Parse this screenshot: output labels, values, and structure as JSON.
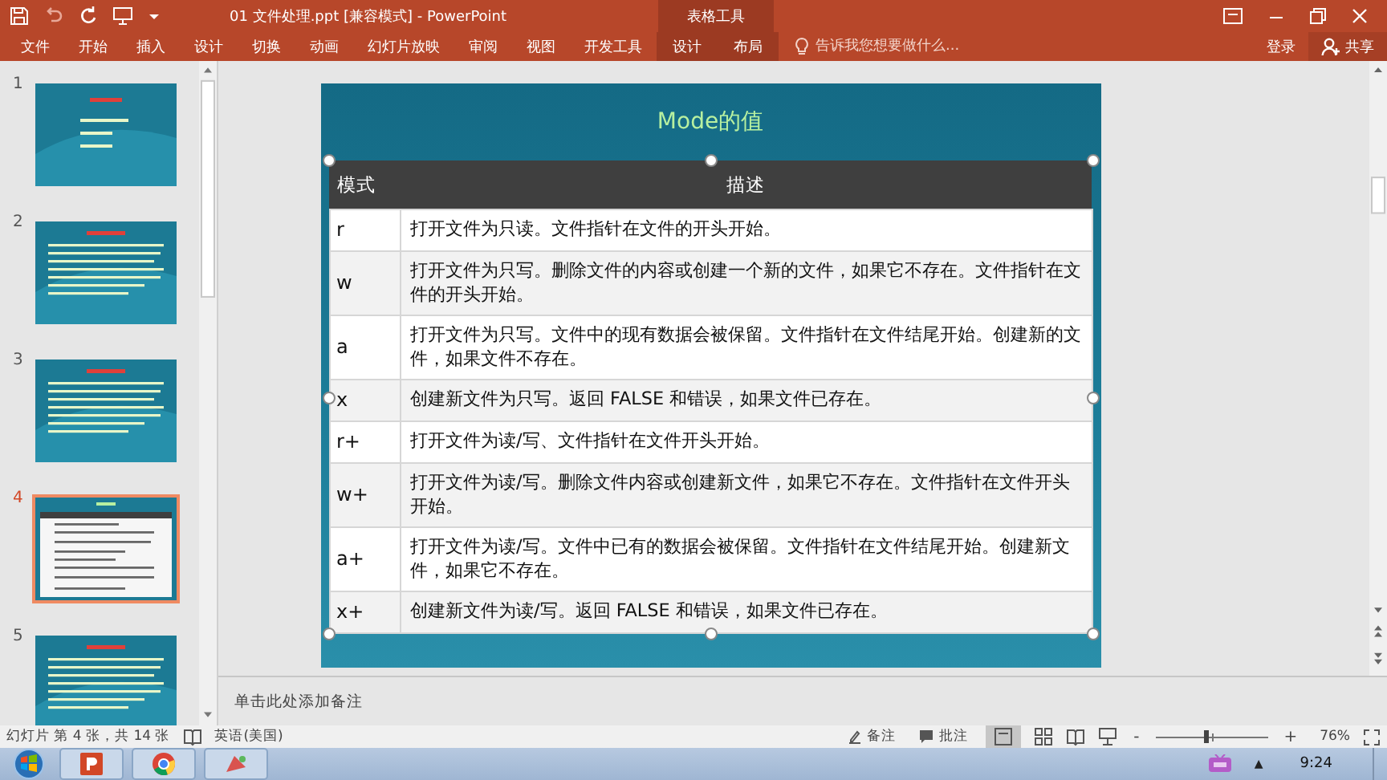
{
  "title_bar": {
    "title": "01  文件处理.ppt [兼容模式] - PowerPoint",
    "context_group": "表格工具"
  },
  "ribbon_tabs": [
    {
      "label": "文件",
      "contextual": false
    },
    {
      "label": "开始",
      "contextual": false
    },
    {
      "label": "插入",
      "contextual": false
    },
    {
      "label": "设计",
      "contextual": false
    },
    {
      "label": "切换",
      "contextual": false
    },
    {
      "label": "动画",
      "contextual": false
    },
    {
      "label": "幻灯片放映",
      "contextual": false
    },
    {
      "label": "审阅",
      "contextual": false
    },
    {
      "label": "视图",
      "contextual": false
    },
    {
      "label": "开发工具",
      "contextual": false
    },
    {
      "label": "设计",
      "contextual": true
    },
    {
      "label": "布局",
      "contextual": true
    }
  ],
  "tell_me": {
    "placeholder": "告诉我您想要做什么..."
  },
  "sign_in": "登录",
  "share": "共享",
  "slides": [
    {
      "number": "1",
      "kind": "list",
      "selected": false
    },
    {
      "number": "2",
      "kind": "text",
      "selected": false
    },
    {
      "number": "3",
      "kind": "text",
      "selected": false
    },
    {
      "number": "4",
      "kind": "table",
      "selected": true
    },
    {
      "number": "5",
      "kind": "text",
      "selected": false
    }
  ],
  "slide": {
    "title": "Mode的值",
    "table": {
      "columns": [
        "模式",
        "描述"
      ],
      "rows": [
        {
          "mode": "r",
          "description": "打开文件为只读。文件指针在文件的开头开始。"
        },
        {
          "mode": "w",
          "description": "打开文件为只写。删除文件的内容或创建一个新的文件，如果它不存在。文件指针在文件的开头开始。"
        },
        {
          "mode": "a",
          "description": "打开文件为只写。文件中的现有数据会被保留。文件指针在文件结尾开始。创建新的文件，如果文件不存在。"
        },
        {
          "mode": "x",
          "description": "创建新文件为只写。返回 FALSE 和错误，如果文件已存在。"
        },
        {
          "mode": "r+",
          "description": "打开文件为读/写、文件指针在文件开头开始。"
        },
        {
          "mode": "w+",
          "description": "打开文件为读/写。删除文件内容或创建新文件，如果它不存在。文件指针在文件开头开始。"
        },
        {
          "mode": "a+",
          "description": "打开文件为读/写。文件中已有的数据会被保留。文件指针在文件结尾开始。创建新文件，如果它不存在。"
        },
        {
          "mode": "x+",
          "description": "创建新文件为读/写。返回 FALSE 和错误，如果文件已存在。"
        }
      ]
    }
  },
  "notes": {
    "placeholder": "单击此处添加备注"
  },
  "status_bar": {
    "slide_info": "幻灯片 第 4 张，共 14 张",
    "language": "英语(美国)",
    "notes": "备注",
    "comments": "批注",
    "zoom_minus": "-",
    "zoom_plus": "+",
    "zoom": {
      "level": 0.45
    },
    "zoom_text": "76%"
  },
  "taskbar": {
    "tray_caret": "▲",
    "time": "9:24"
  }
}
